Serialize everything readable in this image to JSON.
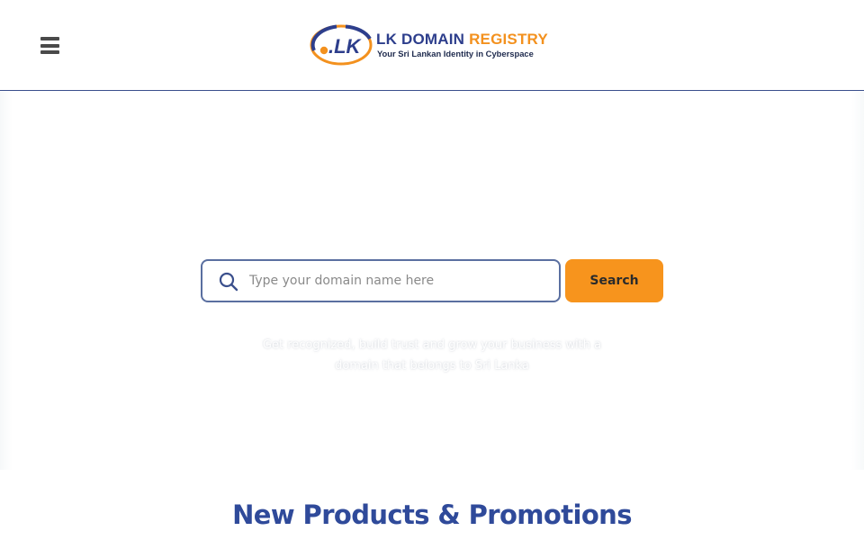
{
  "header": {
    "logo": {
      "mark_text": ".LK",
      "title_part1": "LK DOMAIN",
      "title_part2": "REGISTRY",
      "tagline": "Your Sri Lankan Identity in Cyberspace"
    },
    "menu_icon": "hamburger-menu-icon"
  },
  "search": {
    "placeholder": "Type your domain name here",
    "value": "",
    "icon": "search-icon",
    "button_label": "Search"
  },
  "hero": {
    "tagline": "Get recognized, build trust and grow your business with a domain that belongs to Sri Lanka"
  },
  "promotions": {
    "title": "New Products & Promotions"
  },
  "colors": {
    "brand_blue": "#2d3e8c",
    "brand_orange": "#f7941d",
    "heading_blue": "#2f4a9a",
    "input_border": "#5a6fa0"
  }
}
